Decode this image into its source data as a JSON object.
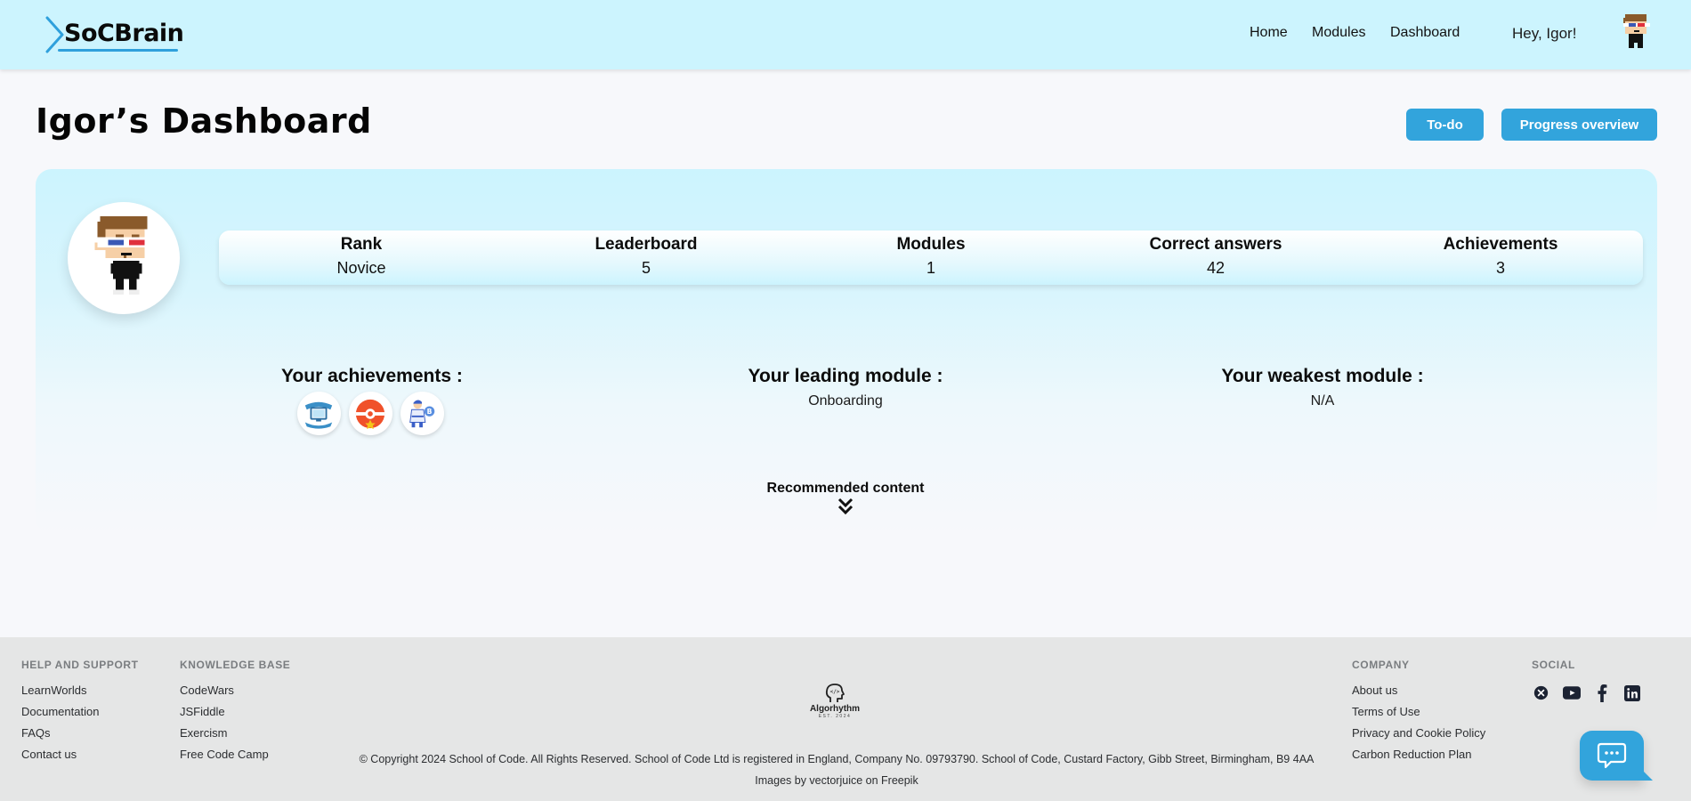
{
  "header": {
    "logo_text": "SoCBrain",
    "nav": [
      {
        "label": "Home"
      },
      {
        "label": "Modules"
      },
      {
        "label": "Dashboard"
      }
    ],
    "greeting": "Hey, Igor!",
    "avatar_icon": "pixel-avatar-3d-glasses"
  },
  "page": {
    "title": "Igor’s Dashboard",
    "buttons": {
      "todo": "To-do",
      "progress": "Progress overview"
    }
  },
  "profile": {
    "avatar_icon": "pixel-avatar-3d-glasses",
    "stats": [
      {
        "label": "Rank",
        "value": "Novice"
      },
      {
        "label": "Leaderboard",
        "value": "5"
      },
      {
        "label": "Modules",
        "value": "1"
      },
      {
        "label": "Correct answers",
        "value": "42"
      },
      {
        "label": "Achievements",
        "value": "3"
      }
    ]
  },
  "sections": {
    "achievements": {
      "title": "Your achievements :",
      "badges": [
        {
          "icon": "computer-banner-badge-icon"
        },
        {
          "icon": "pokeball-star-badge-icon"
        },
        {
          "icon": "karate-b-badge-icon"
        }
      ]
    },
    "leading": {
      "title": "Your leading module :",
      "value": "Onboarding"
    },
    "weakest": {
      "title": "Your weakest module :",
      "value": "N/A"
    }
  },
  "recommended": {
    "label": "Recommended content",
    "icon": "double-chevron-down-icon"
  },
  "footer": {
    "help": {
      "title": "HELP AND SUPPORT",
      "links": [
        "LearnWorlds",
        "Documentation",
        "FAQs",
        "Contact us"
      ]
    },
    "knowledge": {
      "title": "KNOWLEDGE BASE",
      "links": [
        "CodeWars",
        "JSFiddle",
        "Exercism",
        "Free Code Camp"
      ]
    },
    "company": {
      "title": "COMPANY",
      "links": [
        "About us",
        "Terms of Use",
        "Privacy and Cookie Policy",
        "Carbon Reduction Plan"
      ]
    },
    "social": {
      "title": "SOCIAL",
      "icons": [
        "x-icon",
        "youtube-icon",
        "facebook-icon",
        "linkedin-icon"
      ]
    },
    "logo": {
      "name": "Algorhythm",
      "est": "EST. 2024"
    },
    "copyright": "© Copyright 2024 School of Code. All Rights Reserved. School of Code Ltd is registered in England, Company No. 09793790. School of Code, Custard Factory, Gibb Street, Birmingham, B9 4AA",
    "credits": "Images by vectorjuice on Freepik"
  },
  "colors": {
    "header_bg": "#ccf4fe",
    "accent": "#32a4dc",
    "footer_bg": "#e5e6e6",
    "page_bg": "#f7f8fb"
  }
}
